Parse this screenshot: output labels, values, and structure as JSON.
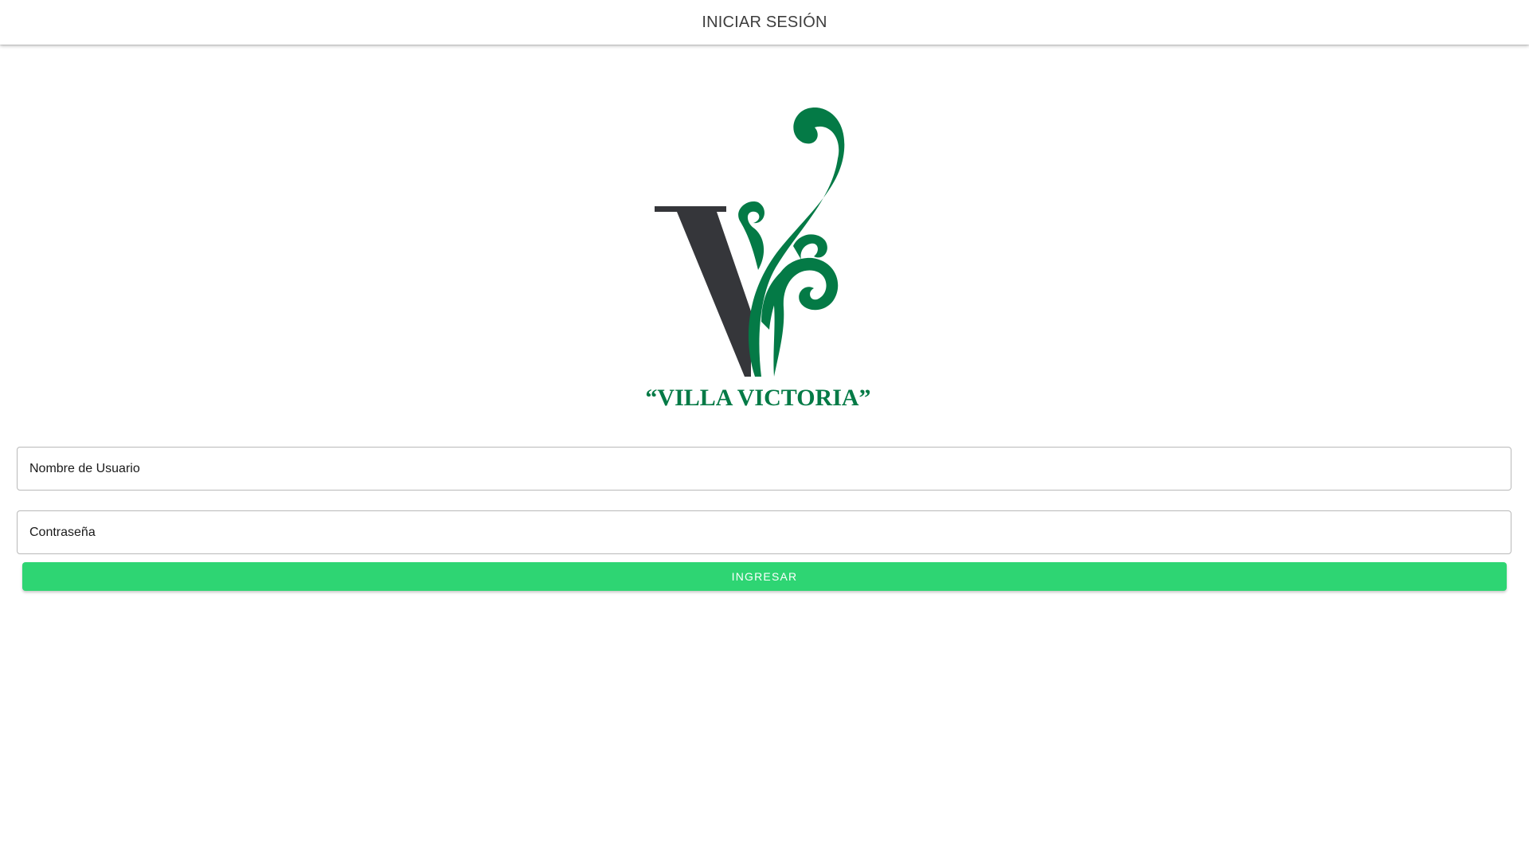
{
  "header": {
    "title": "INICIAR SESIÓN"
  },
  "logo": {
    "text": "“VILLA VICTORIA”",
    "colors": {
      "green": "#047a46",
      "dark": "#35363a"
    }
  },
  "form": {
    "username_placeholder": "Nombre de Usuario",
    "password_placeholder": "Contraseña",
    "submit_label": "INGRESAR",
    "submit_color": "#2ed573"
  }
}
